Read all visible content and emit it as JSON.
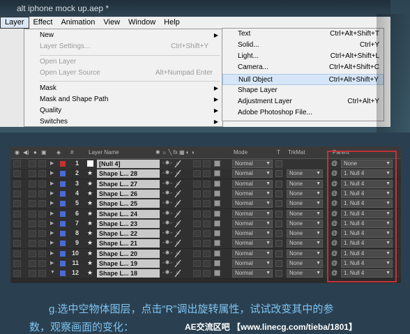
{
  "window": {
    "title": "alt iphone mock up.aep *"
  },
  "menu_bar": [
    "Layer",
    "Effect",
    "Animation",
    "View",
    "Window",
    "Help"
  ],
  "layer_menu": [
    {
      "label": "New",
      "shortcut": "",
      "arrow": "▶",
      "disabled": false
    },
    {
      "label": "Layer Settings...",
      "shortcut": "Ctrl+Shift+Y",
      "arrow": "",
      "disabled": true
    },
    {
      "label": "Open Layer",
      "shortcut": "",
      "arrow": "",
      "disabled": true
    },
    {
      "label": "Open Layer Source",
      "shortcut": "Alt+Numpad Enter",
      "arrow": "",
      "disabled": true
    },
    {
      "label": "Mask",
      "shortcut": "",
      "arrow": "▶",
      "disabled": false
    },
    {
      "label": "Mask and Shape Path",
      "shortcut": "",
      "arrow": "▶",
      "disabled": false
    },
    {
      "label": "Quality",
      "shortcut": "",
      "arrow": "▶",
      "disabled": false
    },
    {
      "label": "Switches",
      "shortcut": "",
      "arrow": "▶",
      "disabled": false
    }
  ],
  "new_submenu": [
    {
      "label": "Text",
      "shortcut": "Ctrl+Alt+Shift+T"
    },
    {
      "label": "Solid...",
      "shortcut": "Ctrl+Y"
    },
    {
      "label": "Light...",
      "shortcut": "Ctrl+Alt+Shift+L"
    },
    {
      "label": "Camera...",
      "shortcut": "Ctrl+Alt+Shift+C"
    },
    {
      "label": "Null Object",
      "shortcut": "Ctrl+Alt+Shift+Y"
    },
    {
      "label": "Shape Layer",
      "shortcut": ""
    },
    {
      "label": "Adjustment Layer",
      "shortcut": "Ctrl+Alt+Y"
    },
    {
      "label": "Adobe Photoshop File...",
      "shortcut": ""
    }
  ],
  "timeline": {
    "headers": {
      "hash": "#",
      "layer_name": "Layer Name",
      "mode": "Mode",
      "t": "T",
      "trkmat": "TrkMat",
      "parent": "Parent"
    },
    "rows": [
      {
        "num": "1",
        "name": "[Null 4]",
        "mode": "Normal",
        "trkmat": "",
        "parent": "None",
        "label_color": "#c8302f"
      },
      {
        "num": "2",
        "name": "Shape L... 28",
        "mode": "Normal",
        "trkmat": "None",
        "parent": "1. Null 4",
        "label_color": "#4a6bd6"
      },
      {
        "num": "3",
        "name": "Shape L... 27",
        "mode": "Normal",
        "trkmat": "None",
        "parent": "1. Null 4",
        "label_color": "#4a6bd6"
      },
      {
        "num": "4",
        "name": "Shape L... 26",
        "mode": "Normal",
        "trkmat": "None",
        "parent": "1. Null 4",
        "label_color": "#4a6bd6"
      },
      {
        "num": "5",
        "name": "Shape L... 25",
        "mode": "Normal",
        "trkmat": "None",
        "parent": "1. Null 4",
        "label_color": "#4a6bd6"
      },
      {
        "num": "6",
        "name": "Shape L... 24",
        "mode": "Normal",
        "trkmat": "None",
        "parent": "1. Null 4",
        "label_color": "#4a6bd6"
      },
      {
        "num": "7",
        "name": "Shape L... 23",
        "mode": "Normal",
        "trkmat": "None",
        "parent": "1. Null 4",
        "label_color": "#4a6bd6"
      },
      {
        "num": "8",
        "name": "Shape L... 22",
        "mode": "Normal",
        "trkmat": "None",
        "parent": "1. Null 4",
        "label_color": "#4a6bd6"
      },
      {
        "num": "9",
        "name": "Shape L... 21",
        "mode": "Normal",
        "trkmat": "None",
        "parent": "1. Null 4",
        "label_color": "#4a6bd6"
      },
      {
        "num": "10",
        "name": "Shape L... 20",
        "mode": "Normal",
        "trkmat": "None",
        "parent": "1. Null 4",
        "label_color": "#4a6bd6"
      },
      {
        "num": "11",
        "name": "Shape L... 19",
        "mode": "Normal",
        "trkmat": "None",
        "parent": "1. Null 4",
        "label_color": "#4a6bd6"
      },
      {
        "num": "12",
        "name": "Shape L... 18",
        "mode": "Normal",
        "trkmat": "None",
        "parent": "1. Null 4",
        "label_color": "#4a6bd6"
      }
    ]
  },
  "caption": {
    "line1": "g.选中空物体图层，点击“R”调出旋转属性，试试改变其中的参",
    "line2": "数，观察画面的变化：",
    "watermark": "AE交流区吧 【www.linecg.com/tieba/1801】"
  },
  "colors": {
    "accent_caption": "#7fc4f2",
    "highlight_border": "#c0323a"
  }
}
